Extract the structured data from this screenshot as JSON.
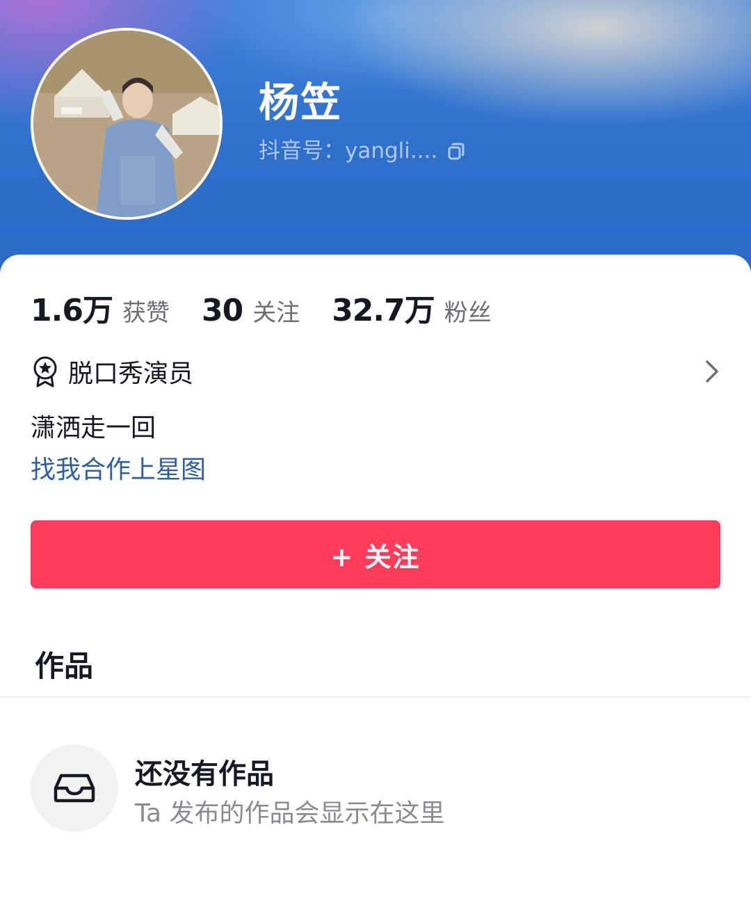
{
  "profile": {
    "name": "杨笠",
    "handle": "抖音号：yangli....",
    "avatar_icon": "profile-photo"
  },
  "stats": [
    {
      "value": "1.6万",
      "label": "获赞"
    },
    {
      "value": "30",
      "label": "关注"
    },
    {
      "value": "32.7万",
      "label": "粉丝"
    }
  ],
  "verification": {
    "text": "脱口秀演员",
    "icon": "verified-badge-icon"
  },
  "bio": "潇洒走一回",
  "link_text": "找我合作上星图",
  "follow_button": {
    "label": "+ 关注",
    "color": "#fe3c5c"
  },
  "tabs": {
    "works": "作品"
  },
  "empty_state": {
    "title": "还没有作品",
    "description": "Ta 发布的作品会显示在这里",
    "icon": "inbox-tray-icon"
  },
  "colors": {
    "header_blue": "#2e6fcc",
    "link": "#2f5e9e",
    "text_primary": "#161823",
    "text_secondary": "#6e6e75"
  }
}
